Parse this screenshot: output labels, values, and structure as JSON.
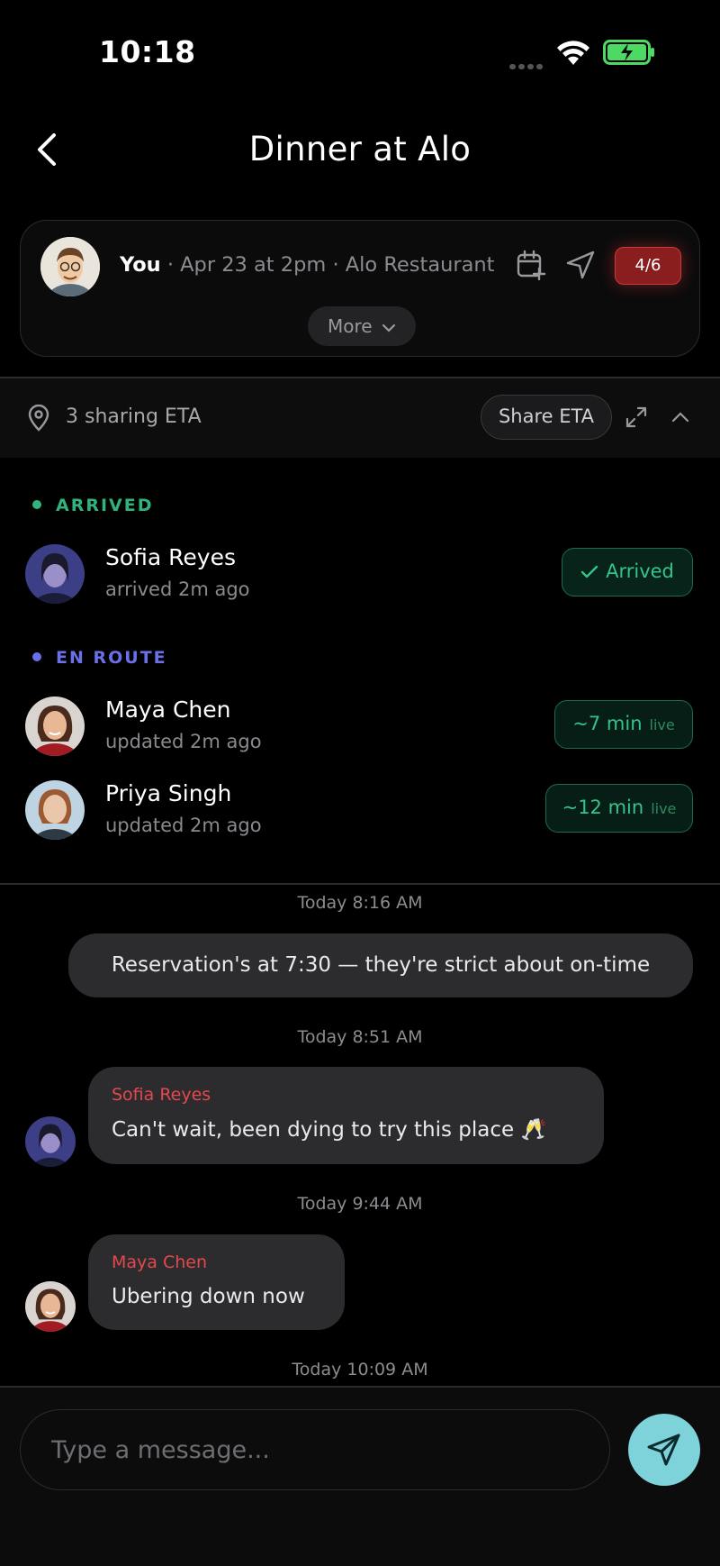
{
  "status": {
    "time": "10:18"
  },
  "header": {
    "title": "Dinner at Alo"
  },
  "event": {
    "host": "You",
    "details": " · Apr 23 at 2pm · Alo Restaurant",
    "count": "4/6",
    "more_label": "More"
  },
  "eta": {
    "summary": "3 sharing ETA",
    "share_label": "Share ETA"
  },
  "sections": {
    "arrived": "ARRIVED",
    "en_route": "EN ROUTE"
  },
  "members": [
    {
      "name": "Sofia Reyes",
      "sub": "arrived 2m ago",
      "status": "Arrived"
    },
    {
      "name": "Maya Chen",
      "sub": "updated 2m ago",
      "eta": "~7 min",
      "live": "live"
    },
    {
      "name": "Priya Singh",
      "sub": "updated 2m ago",
      "eta": "~12 min",
      "live": "live"
    }
  ],
  "messages": [
    {
      "time": "Today 8:16 AM",
      "text": "Reservation's at 7:30 — they're strict about on-time"
    },
    {
      "time": "Today 8:51 AM",
      "sender": "Sofia Reyes",
      "text": "Can't wait, been dying to try this place 🥂"
    },
    {
      "time": "Today 9:44 AM",
      "sender": "Maya Chen",
      "text": "Ubering down now"
    },
    {
      "time": "Today 10:09 AM"
    }
  ],
  "composer": {
    "placeholder": "Type a message..."
  },
  "colors": {
    "accent_send": "#7ed3db",
    "arrived_green": "#2fb47d",
    "en_route_purple": "#6b6fe8",
    "sender_red": "#e5484d",
    "badge_red": "#8a1e1e"
  }
}
